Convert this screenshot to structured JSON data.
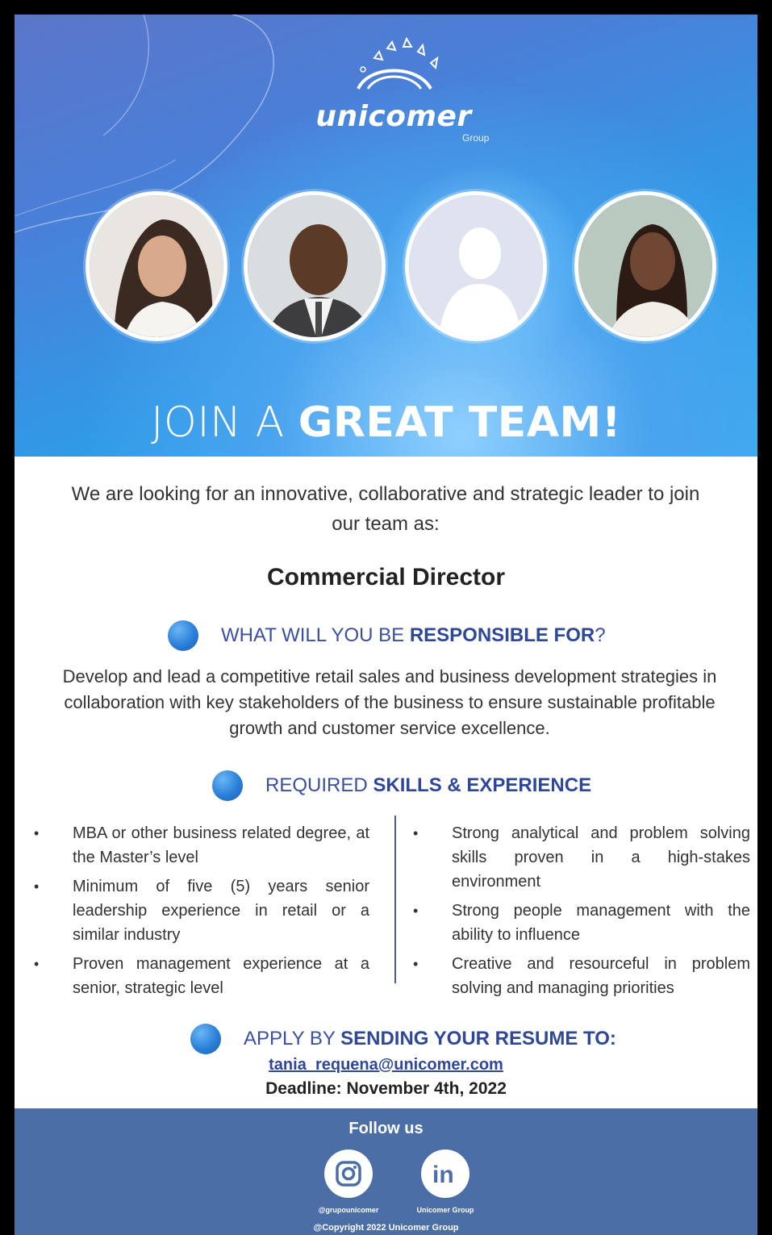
{
  "brand": {
    "name": "unicomer",
    "sub": "Group"
  },
  "headline": {
    "light": "JOIN A ",
    "bold": "GREAT TEAM!"
  },
  "intro": "We are looking for an innovative, collaborative and strategic leader to join our team as:",
  "job_title": "Commercial Director",
  "sections": {
    "responsible": {
      "light": "WHAT WILL YOU BE ",
      "bold": "RESPONSIBLE FOR",
      "end": "?"
    },
    "skills": {
      "light": "REQUIRED ",
      "bold": "SKILLS & EXPERIENCE"
    },
    "apply": {
      "light": "APPLY BY ",
      "bold": "SENDING YOUR RESUME TO:"
    }
  },
  "responsibility_text": "Develop and lead a competitive retail sales and business development strategies in collaboration with key stakeholders of the business to ensure sustainable profitable growth and customer service excellence.",
  "skills_left": [
    "MBA or other business related degree, at the Master’s level",
    "Minimum of five (5) years senior leadership experience in retail or a similar industry",
    "Proven management experience at a senior, strategic level"
  ],
  "skills_right": [
    "Strong analytical and problem solving skills proven in a high-stakes environment",
    "Strong people management with the ability to influence",
    "Creative and resourceful in problem solving and managing priorities"
  ],
  "email": "tania_requena@unicomer.com",
  "deadline": "Deadline: November 4th, 2022",
  "footer": {
    "follow": "Follow us",
    "instagram_handle": "@grupounicomer",
    "linkedin_handle": "Unicomer Group",
    "copyright": "@Copyright 2022 Unicomer Group"
  },
  "colors": {
    "accent": "#2f4799",
    "footer_bg": "#4c6ea6",
    "hero_blue": "#2f9be8"
  }
}
